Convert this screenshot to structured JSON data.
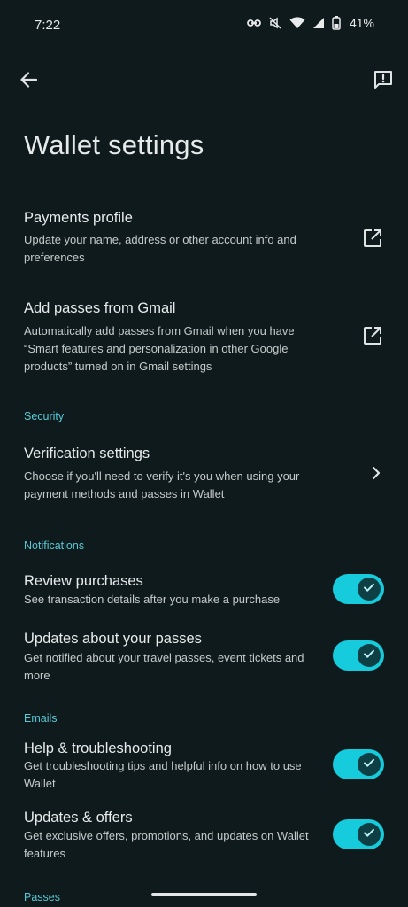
{
  "status_bar": {
    "time": "7:22",
    "battery": "41%"
  },
  "header": {
    "title": "Wallet settings"
  },
  "items": {
    "payments_profile": {
      "title": "Payments profile",
      "desc": "Update your name, address or other account info and preferences"
    },
    "add_passes_gmail": {
      "title": "Add passes from Gmail",
      "desc": "Automatically add passes from Gmail when you have “Smart features and personalization in other Google products” turned on in Gmail settings"
    },
    "verification": {
      "title": "Verification settings",
      "desc": "Choose if you'll need to verify it's you when using your payment methods and passes in Wallet"
    },
    "review_purchases": {
      "title": "Review purchases",
      "desc": "See transaction details after you make a purchase",
      "enabled": true
    },
    "updates_passes": {
      "title": "Updates about your passes",
      "desc": "Get notified about your travel passes, event tickets and more",
      "enabled": true
    },
    "help_troubleshooting": {
      "title": "Help & troubleshooting",
      "desc": "Get troubleshooting tips and helpful info on how to use Wallet",
      "enabled": true
    },
    "updates_offers": {
      "title": "Updates & offers",
      "desc": "Get exclusive offers, promotions, and updates on Wallet features",
      "enabled": true
    }
  },
  "sections": {
    "security": "Security",
    "notifications": "Notifications",
    "emails": "Emails",
    "passes": "Passes"
  },
  "colors": {
    "background": "#0f1a1c",
    "accent": "#57c9d6",
    "toggle_track": "#16cbdb",
    "toggle_knob": "#0d3f44"
  },
  "icons": [
    "link-icon",
    "mute-icon",
    "wifi-icon",
    "cell-signal-icon",
    "battery-icon",
    "back-arrow-icon",
    "feedback-icon",
    "open-external-icon",
    "chevron-right-icon",
    "check-icon"
  ]
}
